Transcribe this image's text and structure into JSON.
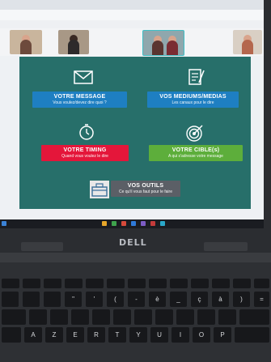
{
  "slide": {
    "cards": [
      {
        "id": "message",
        "title": "VOTRE MESSAGE",
        "subtitle": "Vous voulez/devez dire quoi ?",
        "color": "#1e7fc2"
      },
      {
        "id": "mediums",
        "title": "VOS MEDIUMS/MEDIAS",
        "subtitle": "Les canaux pour le dire",
        "color": "#1e7fc2"
      },
      {
        "id": "timing",
        "title": "VOTRE TIMING",
        "subtitle": "Quand vous voulez le dire",
        "color": "#e4163a"
      },
      {
        "id": "cibles",
        "title": "VOTRE CIBLE(s)",
        "subtitle": "A qui s'adresse votre message",
        "color": "#5dae3b"
      },
      {
        "id": "outils",
        "title": "VOS OUTILS",
        "subtitle": "Ce qu'il vous faut pour le faire",
        "color": "#5b5f66"
      }
    ],
    "background": "#276f6a"
  },
  "icons": [
    "envelope-icon",
    "checklist-icon",
    "timer-icon",
    "target-icon",
    "toolbox-icon"
  ],
  "laptop": {
    "brand": "DELL"
  },
  "keyboard": {
    "row1": [
      "",
      "\"",
      "'",
      "(",
      "-",
      "è",
      "_",
      "ç",
      "à",
      ")",
      "="
    ],
    "row2": [
      "A",
      "Z",
      "E",
      "R",
      "T",
      "Y",
      "U",
      "I",
      "O",
      "P"
    ]
  }
}
